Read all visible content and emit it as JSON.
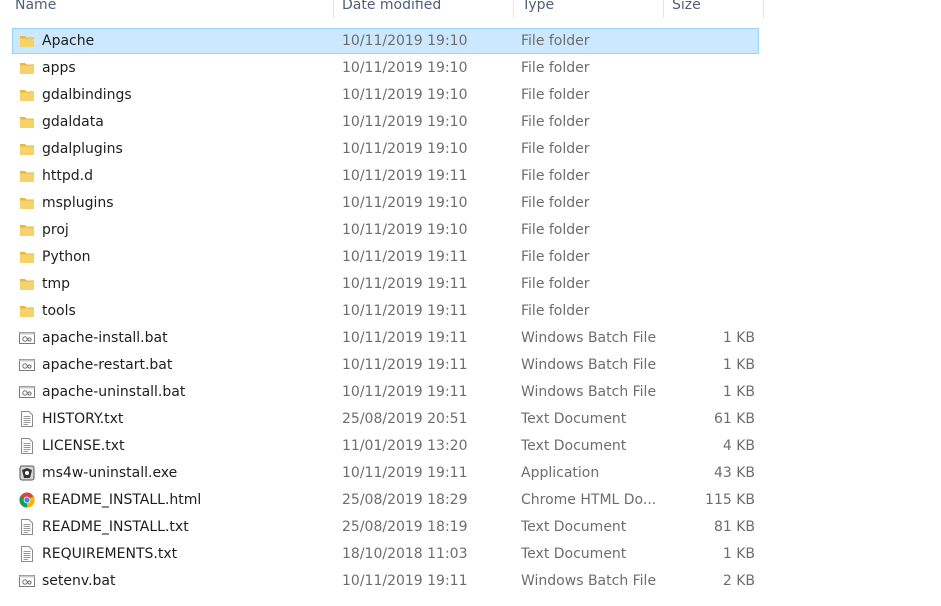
{
  "columns": {
    "name": "Name",
    "date": "Date modified",
    "type": "Type",
    "size": "Size"
  },
  "colors": {
    "selection_bg": "#cce8ff",
    "selection_border": "#99d1ff",
    "folder": "#f3c74e",
    "muted_text": "#6d6d6d"
  },
  "files": [
    {
      "name": "Apache",
      "date": "10/11/2019 19:10",
      "type": "File folder",
      "size": "",
      "icon": "folder-icon",
      "selected": true
    },
    {
      "name": "apps",
      "date": "10/11/2019 19:10",
      "type": "File folder",
      "size": "",
      "icon": "folder-icon"
    },
    {
      "name": "gdalbindings",
      "date": "10/11/2019 19:10",
      "type": "File folder",
      "size": "",
      "icon": "folder-icon"
    },
    {
      "name": "gdaldata",
      "date": "10/11/2019 19:10",
      "type": "File folder",
      "size": "",
      "icon": "folder-icon"
    },
    {
      "name": "gdalplugins",
      "date": "10/11/2019 19:10",
      "type": "File folder",
      "size": "",
      "icon": "folder-icon"
    },
    {
      "name": "httpd.d",
      "date": "10/11/2019 19:11",
      "type": "File folder",
      "size": "",
      "icon": "folder-icon"
    },
    {
      "name": "msplugins",
      "date": "10/11/2019 19:10",
      "type": "File folder",
      "size": "",
      "icon": "folder-icon"
    },
    {
      "name": "proj",
      "date": "10/11/2019 19:10",
      "type": "File folder",
      "size": "",
      "icon": "folder-icon"
    },
    {
      "name": "Python",
      "date": "10/11/2019 19:11",
      "type": "File folder",
      "size": "",
      "icon": "folder-icon"
    },
    {
      "name": "tmp",
      "date": "10/11/2019 19:11",
      "type": "File folder",
      "size": "",
      "icon": "folder-icon"
    },
    {
      "name": "tools",
      "date": "10/11/2019 19:11",
      "type": "File folder",
      "size": "",
      "icon": "folder-icon"
    },
    {
      "name": "apache-install.bat",
      "date": "10/11/2019 19:11",
      "type": "Windows Batch File",
      "size": "1 KB",
      "icon": "batch-file-icon"
    },
    {
      "name": "apache-restart.bat",
      "date": "10/11/2019 19:11",
      "type": "Windows Batch File",
      "size": "1 KB",
      "icon": "batch-file-icon"
    },
    {
      "name": "apache-uninstall.bat",
      "date": "10/11/2019 19:11",
      "type": "Windows Batch File",
      "size": "1 KB",
      "icon": "batch-file-icon"
    },
    {
      "name": "HISTORY.txt",
      "date": "25/08/2019 20:51",
      "type": "Text Document",
      "size": "61 KB",
      "icon": "text-file-icon"
    },
    {
      "name": "LICENSE.txt",
      "date": "11/01/2019 13:20",
      "type": "Text Document",
      "size": "4 KB",
      "icon": "text-file-icon"
    },
    {
      "name": "ms4w-uninstall.exe",
      "date": "10/11/2019 19:11",
      "type": "Application",
      "size": "43 KB",
      "icon": "application-icon"
    },
    {
      "name": "README_INSTALL.html",
      "date": "25/08/2019 18:29",
      "type": "Chrome HTML Do...",
      "size": "115 KB",
      "icon": "chrome-icon"
    },
    {
      "name": "README_INSTALL.txt",
      "date": "25/08/2019 18:19",
      "type": "Text Document",
      "size": "81 KB",
      "icon": "text-file-icon"
    },
    {
      "name": "REQUIREMENTS.txt",
      "date": "18/10/2018 11:03",
      "type": "Text Document",
      "size": "1 KB",
      "icon": "text-file-icon"
    },
    {
      "name": "setenv.bat",
      "date": "10/11/2019 19:11",
      "type": "Windows Batch File",
      "size": "2 KB",
      "icon": "batch-file-icon"
    }
  ]
}
